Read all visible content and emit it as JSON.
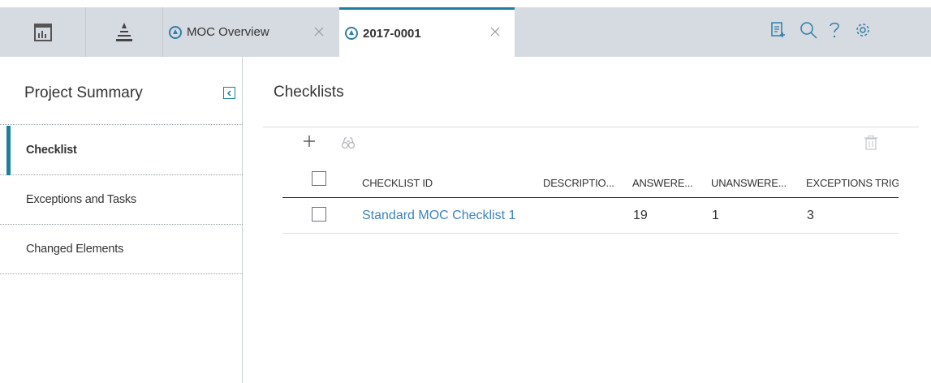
{
  "tabs": [
    {
      "label": "MOC Overview",
      "icon": "moc-icon",
      "active": false
    },
    {
      "label": "2017-0001",
      "icon": "moc-icon",
      "active": true
    }
  ],
  "toolbar_icons": [
    "add-document-icon",
    "search-icon",
    "help-icon",
    "settings-icon"
  ],
  "sidebar": {
    "title": "Project Summary",
    "items": [
      {
        "label": "Checklist",
        "active": true
      },
      {
        "label": "Exceptions and Tasks",
        "active": false
      },
      {
        "label": "Changed Elements",
        "active": false
      }
    ]
  },
  "main": {
    "title": "Checklists",
    "grid": {
      "columns": [
        "CHECKLIST ID",
        "DESCRIPTIO...",
        "ANSWERE...",
        "UNANSWERE...",
        "EXCEPTIONS TRIGG"
      ],
      "rows": [
        {
          "id": "Standard MOC Checklist 1",
          "description": "",
          "answered": "19",
          "unanswered": "1",
          "exceptions": "3"
        }
      ]
    }
  },
  "colors": {
    "accent": "#1a7fa0",
    "link": "#3b82c4",
    "tabbar": "#d6dae1",
    "icon": "#2f7fa8"
  }
}
